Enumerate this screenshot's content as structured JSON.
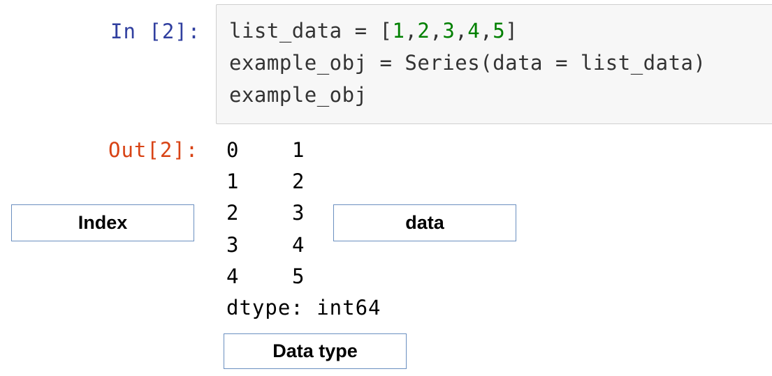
{
  "input": {
    "prompt": "In [2]:",
    "code": {
      "line1_prefix": "list_data = [",
      "line1_n1": "1",
      "line1_c1": ",",
      "line1_n2": "2",
      "line1_c2": ",",
      "line1_n3": "3",
      "line1_c3": ",",
      "line1_n4": "4",
      "line1_c4": ",",
      "line1_n5": "5",
      "line1_suffix": "]",
      "line2": "example_obj = Series(data = list_data)",
      "line3": "example_obj"
    }
  },
  "output": {
    "prompt": "Out[2]:",
    "rows": [
      {
        "index": "0",
        "value": "1"
      },
      {
        "index": "1",
        "value": "2"
      },
      {
        "index": "2",
        "value": "3"
      },
      {
        "index": "3",
        "value": "4"
      },
      {
        "index": "4",
        "value": "5"
      }
    ],
    "dtype": "dtype: int64"
  },
  "annotations": {
    "index_label": "Index",
    "data_label": "data",
    "dtype_label": "Data type"
  },
  "colors": {
    "in_prompt": "#303f9f",
    "out_prompt": "#d84315",
    "number": "#008000",
    "box_border": "#6a8fc0"
  }
}
